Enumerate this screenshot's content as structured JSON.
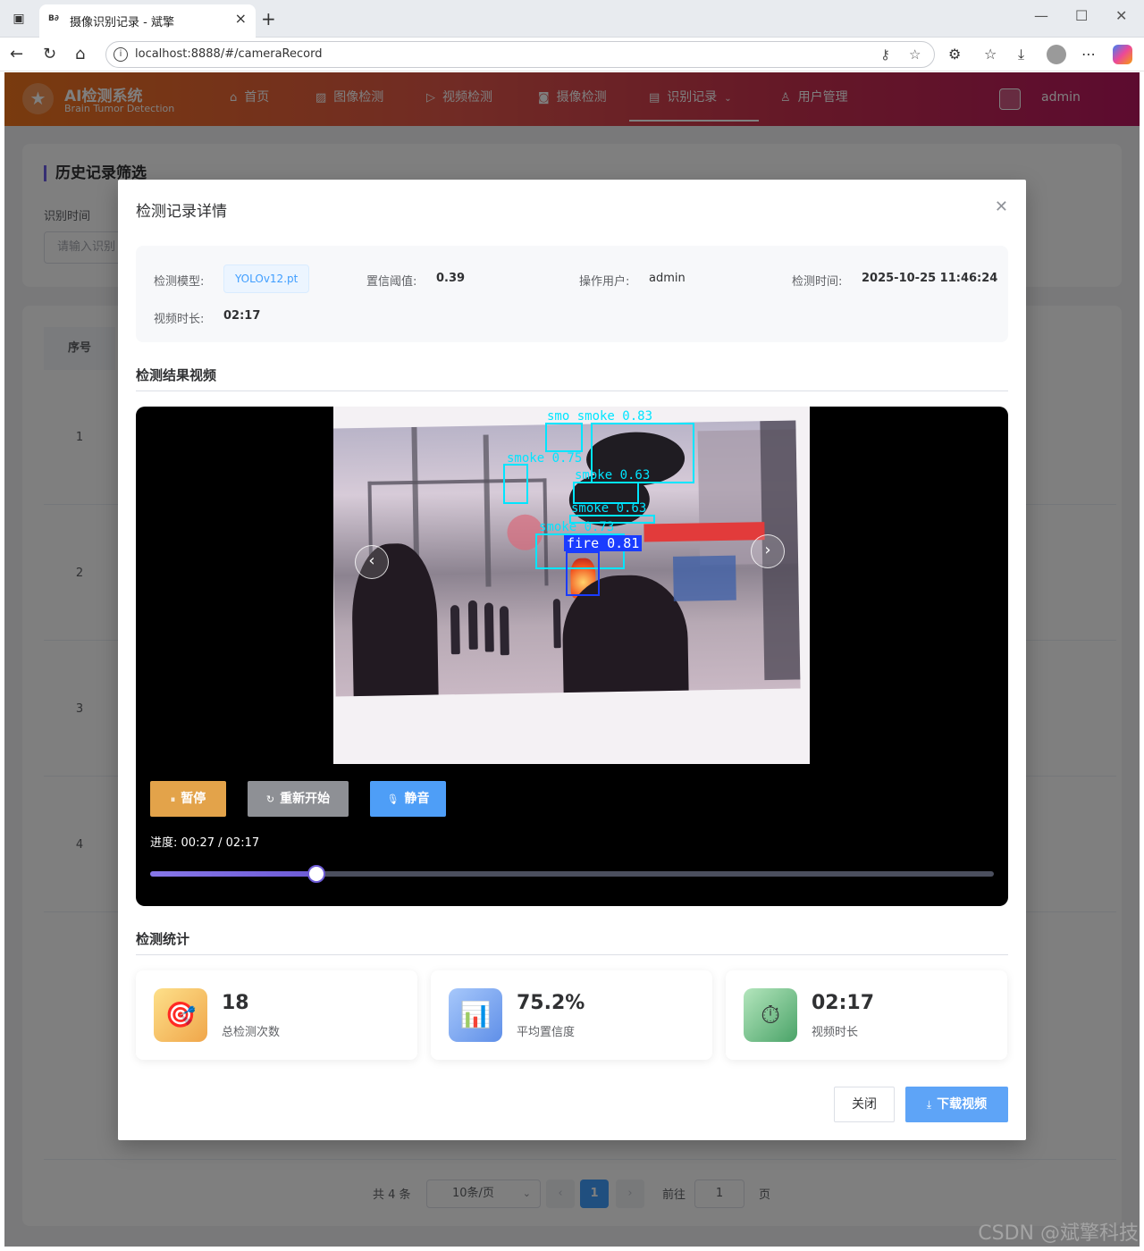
{
  "browser": {
    "tab_favicon": "B∂",
    "tab_title": "摄像识别记录 - 斌擎",
    "url": "localhost:8888/#/cameraRecord"
  },
  "header": {
    "logo_title": "AI检测系统",
    "logo_subtitle": "Brain Tumor Detection",
    "nav": [
      {
        "label": "首页",
        "icon": "home-icon"
      },
      {
        "label": "图像检测",
        "icon": "image-icon"
      },
      {
        "label": "视频检测",
        "icon": "play-circle-icon"
      },
      {
        "label": "摄像检测",
        "icon": "camera-icon"
      },
      {
        "label": "识别记录",
        "icon": "document-icon",
        "active": true
      },
      {
        "label": "用户管理",
        "icon": "user-icon"
      }
    ],
    "username": "admin"
  },
  "filter": {
    "section_title": "历史记录筛选",
    "time_label": "识别时间",
    "time_placeholder": "请输入识别"
  },
  "table": {
    "seq_header": "序号",
    "rows": [
      "1",
      "2",
      "3",
      "4"
    ]
  },
  "pagination": {
    "total": "共 4 条",
    "page_size": "10条/页",
    "current_page": "1",
    "goto_label": "前往",
    "goto_value": "1",
    "page_suffix": "页"
  },
  "dialog": {
    "title": "检测记录详情",
    "info": {
      "model_label": "检测模型:",
      "model_value": "YOLOv12.pt",
      "threshold_label": "置信阈值:",
      "threshold_value": "0.39",
      "user_label": "操作用户:",
      "user_value": "admin",
      "time_label": "检测时间:",
      "time_value": "2025-10-25 11:46:24",
      "duration_label": "视频时长:",
      "duration_value": "02:17"
    },
    "video_section_title": "检测结果视频",
    "video": {
      "detections": [
        {
          "label": "smo smoke 0.83"
        },
        {
          "label": "smoke 0.75"
        },
        {
          "label": "smoke 0.63"
        },
        {
          "label": "smoke 0.63"
        },
        {
          "label": "smoke 0.73"
        },
        {
          "label": "fire 0.81"
        }
      ],
      "pause_label": "暂停",
      "restart_label": "重新开始",
      "mute_label": "静音",
      "progress_label": "进度:",
      "current_time": "00:27",
      "total_time": "02:17",
      "progress_fraction": 0.197
    },
    "stats_section_title": "检测统计",
    "stats": [
      {
        "value": "18",
        "label": "总检测次数",
        "icon": "target-icon"
      },
      {
        "value": "75.2%",
        "label": "平均置信度",
        "icon": "bar-chart-icon"
      },
      {
        "value": "02:17",
        "label": "视频时长",
        "icon": "stopwatch-icon"
      }
    ],
    "close_label": "关闭",
    "download_label": "下载视频"
  },
  "watermark": "CSDN @斌擎科技",
  "colors": {
    "primary": "#409eff",
    "pause": "#e3a34a",
    "restart": "#8e9095",
    "mute": "#4e9ef7",
    "header_start": "#f2761d",
    "header_end": "#b9175f"
  }
}
